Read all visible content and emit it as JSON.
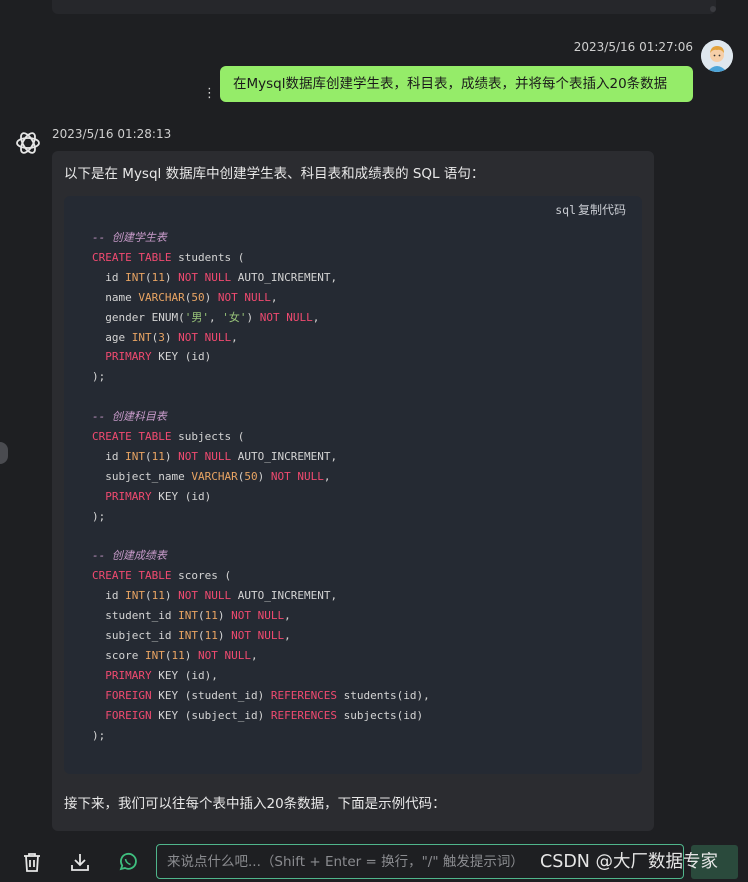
{
  "user_message": {
    "time": "2023/5/16 01:27:06",
    "text": "在Mysql数据库创建学生表，科目表，成绩表，并将每个表插入20条数据"
  },
  "bot_message": {
    "time": "2023/5/16 01:28:13",
    "intro": "以下是在 Mysql 数据库中创建学生表、科目表和成绩表的 SQL 语句：",
    "code_language": "sql",
    "copy_label": "复制代码",
    "code_lines": [
      [
        {
          "t": "-- 创建学生表",
          "c": "cm"
        }
      ],
      [
        {
          "t": "CREATE",
          "c": "kw"
        },
        {
          "t": " "
        },
        {
          "t": "TABLE",
          "c": "kw"
        },
        {
          "t": " students ("
        }
      ],
      [
        {
          "t": "  id "
        },
        {
          "t": "INT",
          "c": "ty"
        },
        {
          "t": "("
        },
        {
          "t": "11",
          "c": "nm"
        },
        {
          "t": ") "
        },
        {
          "t": "NOT",
          "c": "kw"
        },
        {
          "t": " "
        },
        {
          "t": "NULL",
          "c": "kw"
        },
        {
          "t": " AUTO_INCREMENT,"
        }
      ],
      [
        {
          "t": "  name "
        },
        {
          "t": "VARCHAR",
          "c": "ty"
        },
        {
          "t": "("
        },
        {
          "t": "50",
          "c": "nm"
        },
        {
          "t": ") "
        },
        {
          "t": "NOT",
          "c": "kw"
        },
        {
          "t": " "
        },
        {
          "t": "NULL",
          "c": "kw"
        },
        {
          "t": ","
        }
      ],
      [
        {
          "t": "  gender ENUM("
        },
        {
          "t": "'男'",
          "c": "st"
        },
        {
          "t": ", "
        },
        {
          "t": "'女'",
          "c": "st"
        },
        {
          "t": ") "
        },
        {
          "t": "NOT",
          "c": "kw"
        },
        {
          "t": " "
        },
        {
          "t": "NULL",
          "c": "kw"
        },
        {
          "t": ","
        }
      ],
      [
        {
          "t": "  age "
        },
        {
          "t": "INT",
          "c": "ty"
        },
        {
          "t": "("
        },
        {
          "t": "3",
          "c": "nm"
        },
        {
          "t": ") "
        },
        {
          "t": "NOT",
          "c": "kw"
        },
        {
          "t": " "
        },
        {
          "t": "NULL",
          "c": "kw"
        },
        {
          "t": ","
        }
      ],
      [
        {
          "t": "  "
        },
        {
          "t": "PRIMARY",
          "c": "kw"
        },
        {
          "t": " KEY (id)"
        }
      ],
      [
        {
          "t": ");"
        }
      ],
      [
        {
          "t": ""
        }
      ],
      [
        {
          "t": "-- 创建科目表",
          "c": "cm"
        }
      ],
      [
        {
          "t": "CREATE",
          "c": "kw"
        },
        {
          "t": " "
        },
        {
          "t": "TABLE",
          "c": "kw"
        },
        {
          "t": " subjects ("
        }
      ],
      [
        {
          "t": "  id "
        },
        {
          "t": "INT",
          "c": "ty"
        },
        {
          "t": "("
        },
        {
          "t": "11",
          "c": "nm"
        },
        {
          "t": ") "
        },
        {
          "t": "NOT",
          "c": "kw"
        },
        {
          "t": " "
        },
        {
          "t": "NULL",
          "c": "kw"
        },
        {
          "t": " AUTO_INCREMENT,"
        }
      ],
      [
        {
          "t": "  subject_name "
        },
        {
          "t": "VARCHAR",
          "c": "ty"
        },
        {
          "t": "("
        },
        {
          "t": "50",
          "c": "nm"
        },
        {
          "t": ") "
        },
        {
          "t": "NOT",
          "c": "kw"
        },
        {
          "t": " "
        },
        {
          "t": "NULL",
          "c": "kw"
        },
        {
          "t": ","
        }
      ],
      [
        {
          "t": "  "
        },
        {
          "t": "PRIMARY",
          "c": "kw"
        },
        {
          "t": " KEY (id)"
        }
      ],
      [
        {
          "t": ");"
        }
      ],
      [
        {
          "t": ""
        }
      ],
      [
        {
          "t": "-- 创建成绩表",
          "c": "cm"
        }
      ],
      [
        {
          "t": "CREATE",
          "c": "kw"
        },
        {
          "t": " "
        },
        {
          "t": "TABLE",
          "c": "kw"
        },
        {
          "t": " scores ("
        }
      ],
      [
        {
          "t": "  id "
        },
        {
          "t": "INT",
          "c": "ty"
        },
        {
          "t": "("
        },
        {
          "t": "11",
          "c": "nm"
        },
        {
          "t": ") "
        },
        {
          "t": "NOT",
          "c": "kw"
        },
        {
          "t": " "
        },
        {
          "t": "NULL",
          "c": "kw"
        },
        {
          "t": " AUTO_INCREMENT,"
        }
      ],
      [
        {
          "t": "  student_id "
        },
        {
          "t": "INT",
          "c": "ty"
        },
        {
          "t": "("
        },
        {
          "t": "11",
          "c": "nm"
        },
        {
          "t": ") "
        },
        {
          "t": "NOT",
          "c": "kw"
        },
        {
          "t": " "
        },
        {
          "t": "NULL",
          "c": "kw"
        },
        {
          "t": ","
        }
      ],
      [
        {
          "t": "  subject_id "
        },
        {
          "t": "INT",
          "c": "ty"
        },
        {
          "t": "("
        },
        {
          "t": "11",
          "c": "nm"
        },
        {
          "t": ") "
        },
        {
          "t": "NOT",
          "c": "kw"
        },
        {
          "t": " "
        },
        {
          "t": "NULL",
          "c": "kw"
        },
        {
          "t": ","
        }
      ],
      [
        {
          "t": "  score "
        },
        {
          "t": "INT",
          "c": "ty"
        },
        {
          "t": "("
        },
        {
          "t": "11",
          "c": "nm"
        },
        {
          "t": ") "
        },
        {
          "t": "NOT",
          "c": "kw"
        },
        {
          "t": " "
        },
        {
          "t": "NULL",
          "c": "kw"
        },
        {
          "t": ","
        }
      ],
      [
        {
          "t": "  "
        },
        {
          "t": "PRIMARY",
          "c": "kw"
        },
        {
          "t": " KEY (id),"
        }
      ],
      [
        {
          "t": "  "
        },
        {
          "t": "FOREIGN",
          "c": "kw"
        },
        {
          "t": " KEY (student_id) "
        },
        {
          "t": "REFERENCES",
          "c": "kw"
        },
        {
          "t": " students(id),"
        }
      ],
      [
        {
          "t": "  "
        },
        {
          "t": "FOREIGN",
          "c": "kw"
        },
        {
          "t": " KEY (subject_id) "
        },
        {
          "t": "REFERENCES",
          "c": "kw"
        },
        {
          "t": " subjects(id)"
        }
      ],
      [
        {
          "t": ");"
        }
      ]
    ],
    "outro": "接下来，我们可以往每个表中插入20条数据，下面是示例代码："
  },
  "input": {
    "placeholder": "来说点什么吧...（Shift + Enter = 换行，\"/\" 触发提示词）",
    "value": ""
  },
  "toolbar_icons": [
    "trash-icon",
    "download-icon",
    "whatsapp-icon"
  ],
  "watermark": "CSDN @大厂数据专家",
  "colors": {
    "user_bubble": "#95ec69",
    "keyword": "#f04a70",
    "type": "#e8a463",
    "comment": "#c79ac9",
    "string": "#98c379",
    "input_border": "#4fb58b"
  }
}
